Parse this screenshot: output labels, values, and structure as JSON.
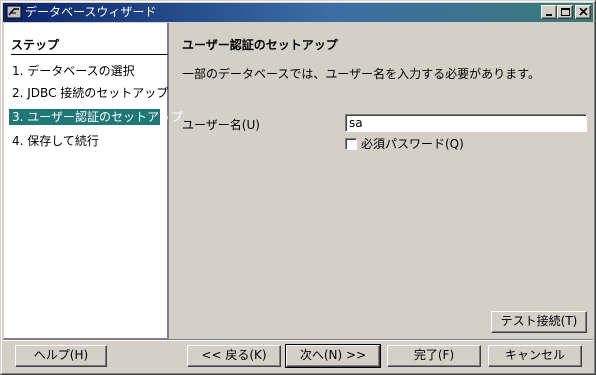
{
  "window": {
    "title": "データベースウィザード"
  },
  "steps": {
    "heading": "ステップ",
    "items": [
      {
        "label": "1.  データベースの選択",
        "active": false
      },
      {
        "label": "2.  JDBC 接続のセットアップ",
        "active": false
      },
      {
        "label": "3.  ユーザー認証のセットアップ",
        "active": true
      },
      {
        "label": "4.  保存して続行",
        "active": false
      }
    ]
  },
  "main": {
    "heading": "ユーザー認証のセットアップ",
    "description": "一部のデータベースでは、ユーザー名を入力する必要があります。",
    "username_label": "ユーザー名(U)",
    "username_value": "sa",
    "password_checkbox_label": "必須パスワード(Q)",
    "password_checked": false,
    "test_button": "テスト接続(T)"
  },
  "footer": {
    "help": "ヘルプ(H)",
    "back": "<< 戻る(K)",
    "next": "次へ(N) >>",
    "finish": "完了(F)",
    "cancel": "キャンセル"
  },
  "colors": {
    "dialog_bg": "#d4d0c8",
    "title_gradient_start": "#0a246a",
    "title_gradient_end": "#3a7a78",
    "active_step": "#1f7875"
  },
  "icons": {
    "app": "app-wizard-icon",
    "minimize": "minimize-icon",
    "maximize": "maximize-icon",
    "close": "close-icon"
  }
}
